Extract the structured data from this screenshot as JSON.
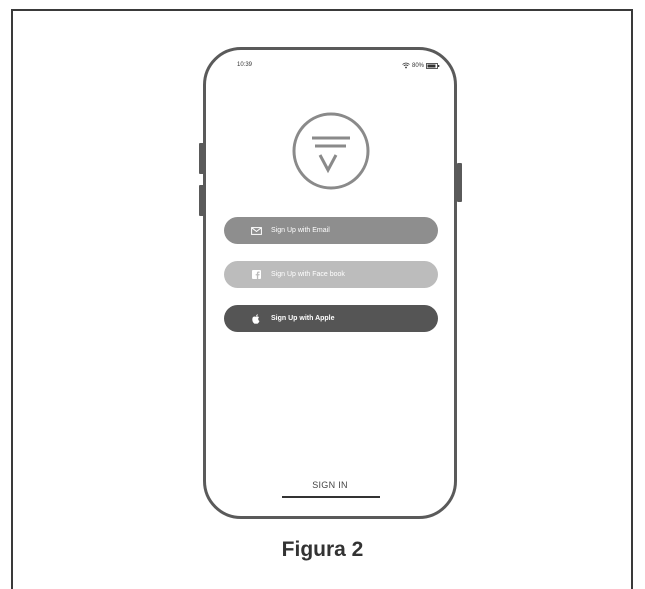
{
  "status_bar": {
    "time": "10:39",
    "battery": "80%"
  },
  "buttons": {
    "email_label": "Sign Up with Email",
    "facebook_label": "Sign Up with Face book",
    "apple_label": "Sign Up with Apple"
  },
  "signin_label": "SIGN IN",
  "caption": "Figura 2",
  "icons": {
    "logo": "brand-logo-icon",
    "email": "envelope-icon",
    "facebook": "facebook-icon",
    "apple": "apple-icon",
    "wifi": "wifi-icon",
    "battery": "battery-icon"
  },
  "colors": {
    "email_button": "#8e8e8e",
    "facebook_button": "#bcbcbc",
    "apple_button": "#555555",
    "phone_outline": "#5a5a5a"
  }
}
